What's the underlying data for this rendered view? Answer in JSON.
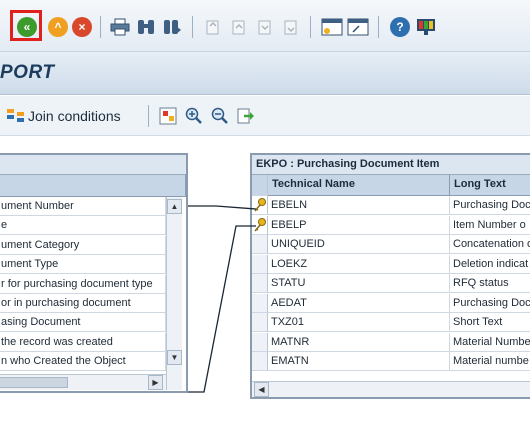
{
  "toolbar": {
    "icons": [
      "back-icon",
      "exit-icon",
      "cancel-icon",
      "print-icon",
      "find-icon",
      "find-next-icon",
      "first-page-icon",
      "previous-page-icon",
      "next-page-icon",
      "last-page-icon",
      "create-session-icon",
      "shortcut-icon",
      "help-icon",
      "customize-layout-icon"
    ]
  },
  "title": {
    "text": "PORT"
  },
  "subtoolbar": {
    "join_conditions_label": "Join conditions"
  },
  "left_table": {
    "rows": [
      "ument Number",
      "e",
      "ument Category",
      "ument Type",
      "r for purchasing document type",
      "or in purchasing document",
      "asing Document",
      "the record was created",
      "n who Created the Object"
    ]
  },
  "right_table": {
    "title": "EKPO : Purchasing Document Item",
    "columns": {
      "technical": "Technical Name",
      "long": "Long Text"
    },
    "rows": [
      {
        "tech": "EBELN",
        "long": "Purchasing Doc",
        "key": true
      },
      {
        "tech": "EBELP",
        "long": "Item Number o",
        "key": true
      },
      {
        "tech": "UNIQUEID",
        "long": "Concatenation o",
        "key": false
      },
      {
        "tech": "LOEKZ",
        "long": "Deletion indicat",
        "key": false
      },
      {
        "tech": "STATU",
        "long": "RFQ status",
        "key": false
      },
      {
        "tech": "AEDAT",
        "long": "Purchasing Doc",
        "key": false
      },
      {
        "tech": "TXZ01",
        "long": "Short Text",
        "key": false
      },
      {
        "tech": "MATNR",
        "long": "Material Numbe",
        "key": false
      },
      {
        "tech": "EMATN",
        "long": "Material numbe",
        "key": false
      }
    ]
  },
  "colors": {
    "highlight_border": "#e0201c",
    "title_text": "#1b3c5e",
    "join_line": "#1a2633"
  }
}
